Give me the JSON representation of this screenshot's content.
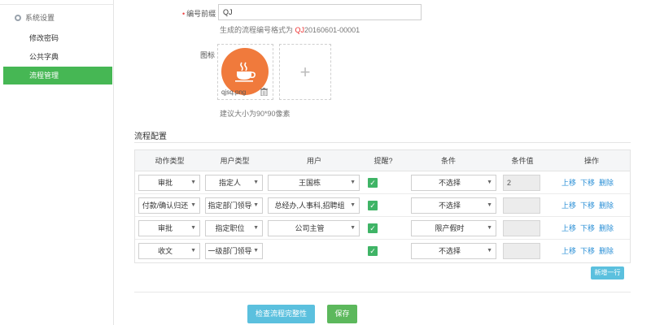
{
  "sidebar": {
    "group_label": "系统设置",
    "items": [
      {
        "label": "修改密码",
        "active": false
      },
      {
        "label": "公共字典",
        "active": false
      },
      {
        "label": "流程管理",
        "active": true
      }
    ]
  },
  "form": {
    "prefix_label": "编号前缀",
    "prefix_value": "QJ",
    "hint_prefix": "生成的流程编号格式为 ",
    "hint_code": "QJ",
    "hint_suffix": "20160601-00001",
    "icon_label": "图标",
    "icon_file": "qjsq.png",
    "icon_size_hint": "建议大小为90*90像素"
  },
  "config": {
    "title": "流程配置",
    "columns": [
      "动作类型",
      "用户类型",
      "用户",
      "提醒?",
      "条件",
      "条件值",
      "操作"
    ],
    "rows": [
      {
        "action": "审批",
        "user_type": "指定人",
        "user": "王国栋",
        "remind": true,
        "condition": "不选择",
        "cond_value": "2"
      },
      {
        "action": "付款/确认归还",
        "user_type": "指定部门领导",
        "user": "总经办,人事科,招聘组",
        "remind": true,
        "condition": "不选择",
        "cond_value": ""
      },
      {
        "action": "审批",
        "user_type": "指定职位",
        "user": "公司主管",
        "remind": true,
        "condition": "限产假时",
        "cond_value": ""
      },
      {
        "action": "收文",
        "user_type": "一级部门领导",
        "user": "",
        "remind": true,
        "condition": "不选择",
        "cond_value": ""
      }
    ],
    "ops": [
      "上移",
      "下移",
      "删除"
    ],
    "add_row_label": "新增一行"
  },
  "buttons": {
    "check": "检查流程完整性",
    "save": "保存"
  },
  "colors": {
    "active_green": "#46b754",
    "icon_orange": "#f07a3c",
    "link_blue": "#2a8fd6",
    "button_cyan": "#5bc0de",
    "button_green": "#5cb85c"
  }
}
